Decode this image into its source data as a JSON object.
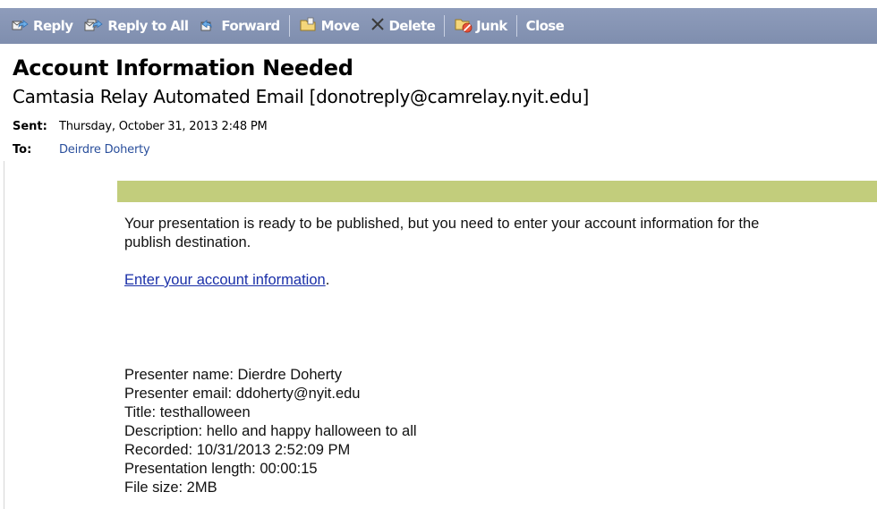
{
  "toolbar": {
    "buttons": [
      {
        "label": "Reply",
        "icon": "reply-icon"
      },
      {
        "label": "Reply to All",
        "icon": "reply-all-icon"
      },
      {
        "label": "Forward",
        "icon": "forward-icon"
      },
      {
        "label": "Move",
        "icon": "move-icon"
      },
      {
        "label": "Delete",
        "icon": "delete-icon"
      },
      {
        "label": "Junk",
        "icon": "junk-icon"
      },
      {
        "label": "Close"
      }
    ],
    "colors": {
      "background": "#8493b3",
      "text": "#ffffff"
    }
  },
  "message": {
    "subject": "Account Information Needed",
    "sender": "Camtasia Relay Automated Email [donotreply@camrelay.nyit.edu]",
    "sent_label": "Sent:",
    "sent_value": "Thursday, October 31, 2013 2:48 PM",
    "to_label": "To:",
    "to_value": "Deirdre Doherty"
  },
  "body": {
    "accent_color": "#c2cd7c",
    "paragraph_line1": "Your presentation is ready to be published, but you need to enter your account information for the",
    "paragraph_line2": "publish destination.",
    "link_text": "Enter your account information",
    "link_suffix": ".",
    "details": [
      "Presenter name: Dierdre Doherty",
      "Presenter email: ddoherty@nyit.edu",
      "Title: testhalloween",
      "Description: hello and happy halloween to all",
      "Recorded: 10/31/2013 2:52:09 PM",
      "Presentation length: 00:00:15",
      "File size: 2MB"
    ]
  }
}
